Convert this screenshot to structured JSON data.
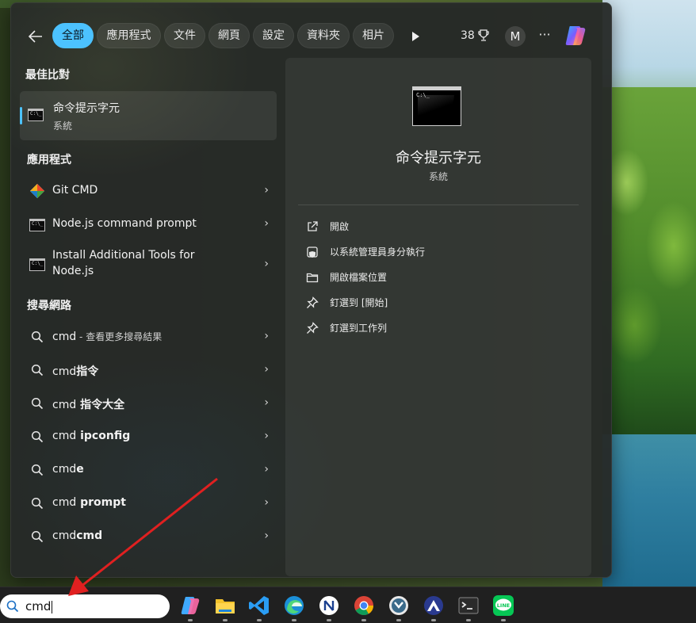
{
  "filter_bar": {
    "tabs": [
      {
        "label": "全部",
        "active": true
      },
      {
        "label": "應用程式",
        "active": false
      },
      {
        "label": "文件",
        "active": false
      },
      {
        "label": "網頁",
        "active": false
      },
      {
        "label": "設定",
        "active": false
      },
      {
        "label": "資料夾",
        "active": false
      },
      {
        "label": "相片",
        "active": false
      }
    ],
    "points": "38",
    "avatar_initial": "M",
    "more_label": "···"
  },
  "best_match": {
    "heading": "最佳比對",
    "title": "命令提示字元",
    "subtitle": "系統"
  },
  "apps": {
    "heading": "應用程式",
    "items": [
      {
        "label": "Git CMD",
        "icon": "git-icon"
      },
      {
        "label": "Node.js command prompt",
        "icon": "cmd-icon"
      },
      {
        "label_line1": "Install Additional Tools for",
        "label_line2": "Node.js",
        "icon": "cmd-icon"
      }
    ]
  },
  "web": {
    "heading": "搜尋網路",
    "items": [
      {
        "label": "cmd",
        "suffix": " - 查看更多搜尋結果"
      },
      {
        "label": "cmd",
        "bold": "指令"
      },
      {
        "label": "cmd",
        "bold": " 指令大全"
      },
      {
        "label": "cmd",
        "bold": " ipconfig"
      },
      {
        "label": "cmd",
        "bold": "e"
      },
      {
        "label": "cmd",
        "bold": " prompt"
      },
      {
        "label": "cmd",
        "bold": "cmd"
      }
    ]
  },
  "detail": {
    "title": "命令提示字元",
    "subtitle": "系統",
    "actions": [
      {
        "label": "開啟",
        "icon": "open-external-icon"
      },
      {
        "label": "以系統管理員身分執行",
        "icon": "shield-icon"
      },
      {
        "label": "開啟檔案位置",
        "icon": "folder-icon"
      },
      {
        "label": "釘選到 [開始]",
        "icon": "pin-icon"
      },
      {
        "label": "釘選到工作列",
        "icon": "pin-icon"
      }
    ]
  },
  "taskbar": {
    "search_value": "cmd",
    "apps": [
      "copilot-icon",
      "file-explorer-icon",
      "vscode-icon",
      "edge-icon",
      "notion-like-icon",
      "chrome-icon",
      "game-icon",
      "vpn-icon",
      "terminal-icon",
      "line-icon"
    ]
  },
  "colors": {
    "accent": "#4cc2ff",
    "arrow": "#e02020"
  }
}
